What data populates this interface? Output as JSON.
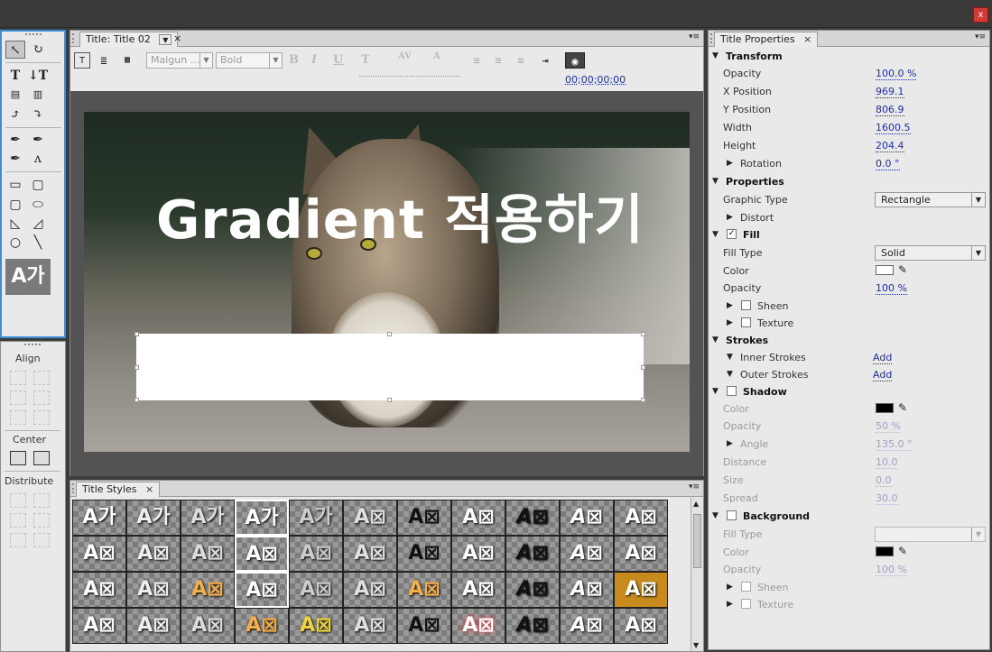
{
  "window": {
    "close_label": "x"
  },
  "tools": {
    "text_sample": "A가",
    "align_label": "Align",
    "center_label": "Center",
    "distribute_label": "Distribute"
  },
  "title_panel": {
    "tab_label": "Title: Title 02",
    "tab_close": "×",
    "font_family": "Malgun ...",
    "font_style": "Bold",
    "timecode": "00;00;00;00",
    "title_text": "Gradient 적용하기"
  },
  "styles_panel": {
    "tab_label": "Title Styles",
    "tab_close": "×",
    "swatches": [
      "A가",
      "A가",
      "A가",
      "A가",
      "A가",
      "A⊠",
      "A⊠",
      "A⊠",
      "A⊠",
      "A⊠",
      "A⊠",
      "A⊠",
      "A⊠",
      "A⊠",
      "A⊠",
      "A⊠",
      "A⊠",
      "A⊠",
      "A⊠",
      "A⊠",
      "A⊠",
      "A⊠",
      "A⊠",
      "A⊠",
      "A⊠",
      "A⊠",
      "A⊠",
      "A⊠",
      "A⊠",
      "A⊠",
      "A⊠",
      "A⊠",
      "A⊠",
      "A⊠",
      "A⊠",
      "A⊠",
      "A⊠",
      "A⊠",
      "A⊠",
      "A⊠",
      "A⊠",
      "A⊠",
      "A⊠",
      "A⊠"
    ]
  },
  "properties_panel": {
    "tab_label": "Title Properties",
    "tab_close": "×",
    "transform": {
      "header": "Transform",
      "opacity_label": "Opacity",
      "opacity": "100.0 %",
      "x_label": "X Position",
      "x": "969.1",
      "y_label": "Y Position",
      "y": "806.9",
      "width_label": "Width",
      "width": "1600.5",
      "height_label": "Height",
      "height": "204.4",
      "rotation_label": "Rotation",
      "rotation": "0.0 °"
    },
    "properties": {
      "header": "Properties",
      "graphic_type_label": "Graphic Type",
      "graphic_type": "Rectangle",
      "distort_label": "Distort"
    },
    "fill": {
      "header": "Fill",
      "fill_type_label": "Fill Type",
      "fill_type": "Solid",
      "color_label": "Color",
      "color": "#ffffff",
      "opacity_label": "Opacity",
      "opacity": "100 %",
      "sheen_label": "Sheen",
      "texture_label": "Texture"
    },
    "strokes": {
      "header": "Strokes",
      "inner_label": "Inner Strokes",
      "inner_add": "Add",
      "outer_label": "Outer Strokes",
      "outer_add": "Add"
    },
    "shadow": {
      "header": "Shadow",
      "color_label": "Color",
      "color": "#000000",
      "opacity_label": "Opacity",
      "opacity": "50 %",
      "angle_label": "Angle",
      "angle": "135.0 °",
      "distance_label": "Distance",
      "distance": "10.0",
      "size_label": "Size",
      "size": "0.0",
      "spread_label": "Spread",
      "spread": "30.0"
    },
    "background": {
      "header": "Background",
      "fill_type_label": "Fill Type",
      "color_label": "Color",
      "color": "#000000",
      "opacity_label": "Opacity",
      "opacity": "100 %",
      "sheen_label": "Sheen",
      "texture_label": "Texture"
    }
  }
}
